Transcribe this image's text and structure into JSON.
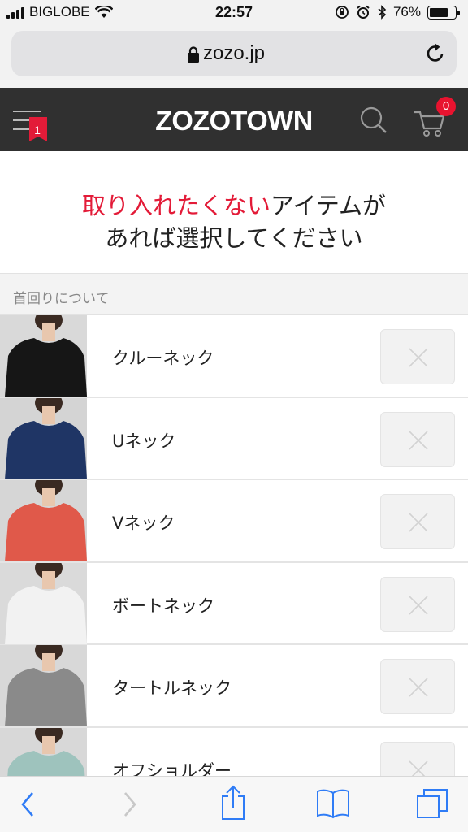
{
  "status_bar": {
    "carrier": "BIGLOBE",
    "time": "22:57",
    "battery": "76%",
    "battery_level": 0.76
  },
  "address_bar": {
    "url": "zozo.jp"
  },
  "header": {
    "logo": "ZOZOTOWN",
    "menu_badge": "1",
    "cart_count": "0"
  },
  "prompt": {
    "highlight": "取り入れたくない",
    "line1_rest": "アイテムが",
    "line2": "あれば選択してください"
  },
  "section": {
    "title": "首回りについて"
  },
  "items": [
    {
      "label": "クルーネック",
      "garment_color": "#161616",
      "bg": "#d9d9d9"
    },
    {
      "label": "Uネック",
      "garment_color": "#1f3565",
      "bg": "#d4d4d4"
    },
    {
      "label": "Vネック",
      "garment_color": "#e0594a",
      "bg": "#d6d6d6"
    },
    {
      "label": "ボートネック",
      "garment_color": "#f2f2f2",
      "bg": "#dadada"
    },
    {
      "label": "タートルネック",
      "garment_color": "#8a8a8a",
      "bg": "#d8d8d8"
    },
    {
      "label": "オフショルダー",
      "garment_color": "#9ec3bd",
      "bg": "#d8d8d8"
    }
  ],
  "colors": {
    "accent_red": "#e31b38",
    "header_bg": "#303030",
    "ios_blue": "#2f7cf6"
  }
}
